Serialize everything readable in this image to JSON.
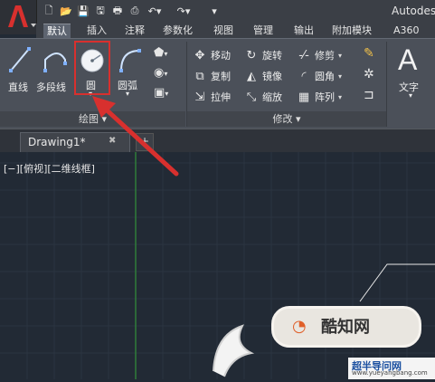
{
  "title": "Autodes",
  "tabs": [
    {
      "label": "默认",
      "active": true
    },
    {
      "label": "插入"
    },
    {
      "label": "注释"
    },
    {
      "label": "参数化"
    },
    {
      "label": "视图"
    },
    {
      "label": "管理"
    },
    {
      "label": "输出"
    },
    {
      "label": "附加模块"
    },
    {
      "label": "A360"
    }
  ],
  "draw_panel": {
    "title": "绘图",
    "line": "直线",
    "polyline": "多段线",
    "circle": "圆",
    "arc": "圆弧"
  },
  "modify_panel": {
    "title": "修改",
    "move": "移动",
    "rotate": "旋转",
    "trim": "修剪",
    "copy": "复制",
    "mirror": "镜像",
    "fillet": "圆角",
    "stretch": "拉伸",
    "scale": "缩放",
    "array": "阵列"
  },
  "text_panel": {
    "glyph": "A",
    "label": "文字"
  },
  "document_tab": {
    "name": "Drawing1*",
    "close": "✖"
  },
  "view_label": "[−][俯视][二维线框]",
  "watermark": {
    "text": "酷知网",
    "site": "超半导问网",
    "url": "www.yueyangbang.com"
  },
  "colors": {
    "accent_red": "#d8302e",
    "ribbon": "#4b5059",
    "canvas": "#222a35",
    "grid_green": "#2f7d3a"
  }
}
